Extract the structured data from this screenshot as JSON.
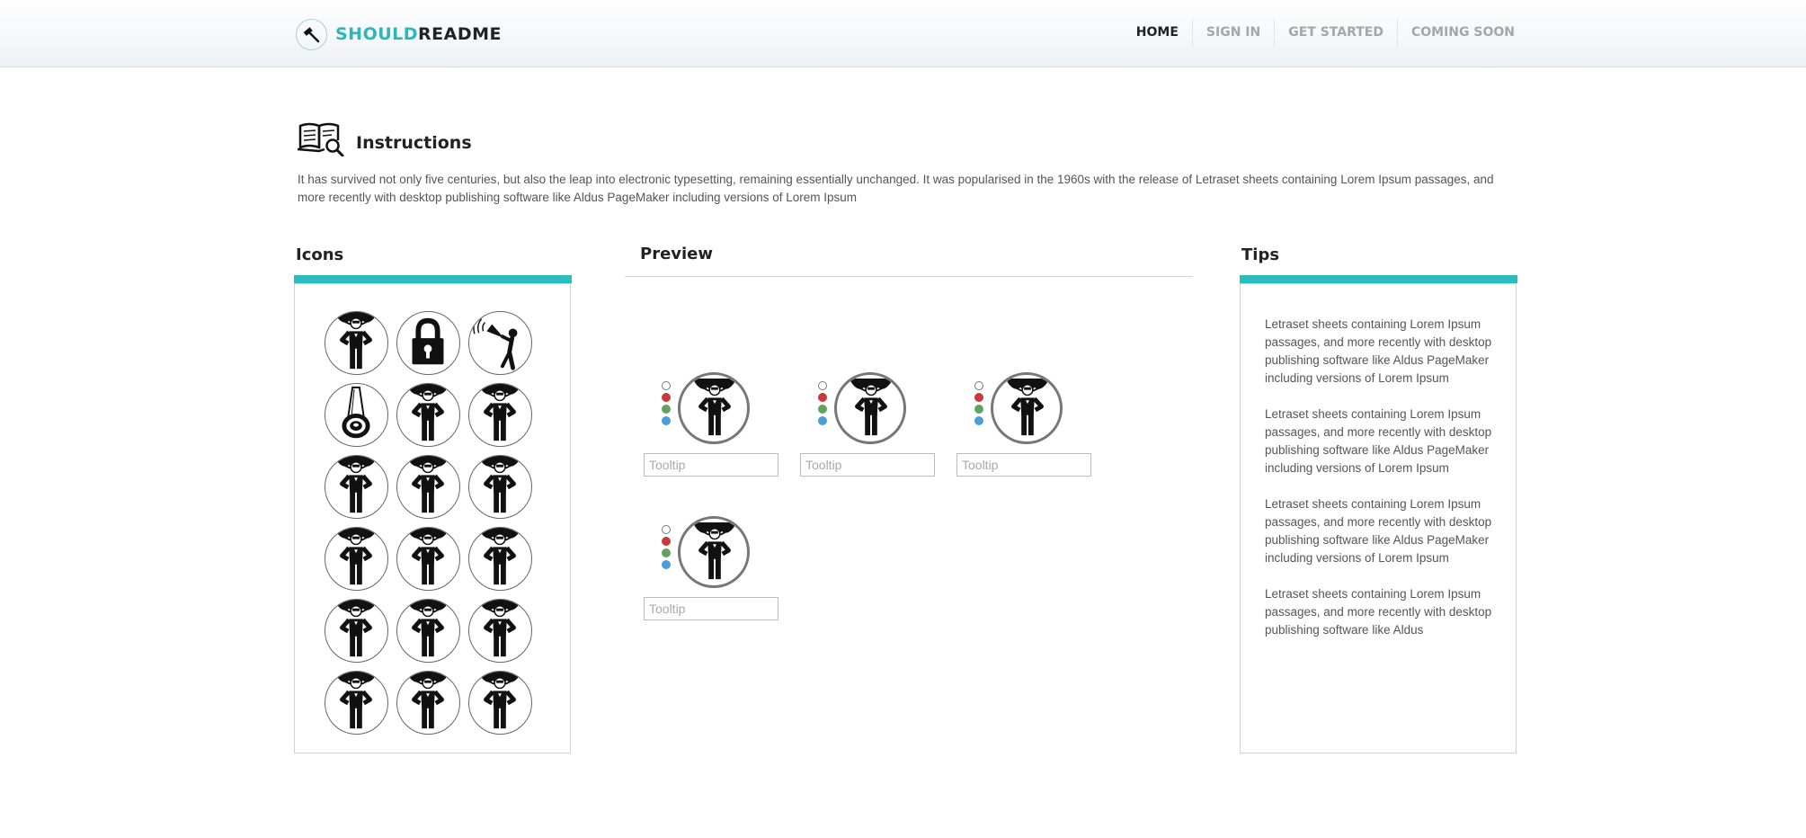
{
  "header": {
    "logo": {
      "accent": "SHOULD",
      "rest": "README",
      "icon": "hammer-icon"
    },
    "nav": [
      {
        "label": "HOME",
        "active": true
      },
      {
        "label": "SIGN IN",
        "active": false
      },
      {
        "label": "GET STARTED",
        "active": false
      },
      {
        "label": "COMING SOON",
        "active": false
      }
    ]
  },
  "instructions": {
    "icon": "book-search-icon",
    "title": "Instructions",
    "text": "It has survived not only five centuries, but also the leap into electronic typesetting, remaining essentially unchanged. It was popularised in the 1960s with the release of Letraset sheets containing Lorem Ipsum passages, and more recently with desktop publishing software like Aldus PageMaker including versions of Lorem Ipsum"
  },
  "icons_panel": {
    "title": "Icons",
    "items": [
      "superhero-icon",
      "lock-icon",
      "megaphone-person-icon",
      "flashlight-icon",
      "superhero-icon",
      "superhero-icon",
      "superhero-icon",
      "superhero-icon",
      "superhero-icon",
      "superhero-icon",
      "superhero-icon",
      "superhero-icon",
      "superhero-icon",
      "superhero-icon",
      "superhero-icon",
      "superhero-icon",
      "superhero-icon",
      "superhero-icon"
    ]
  },
  "preview": {
    "title": "Preview",
    "items": [
      {
        "icon": "superhero-icon",
        "tooltip_value": "",
        "tooltip_placeholder": "Tooltip"
      },
      {
        "icon": "superhero-icon",
        "tooltip_value": "",
        "tooltip_placeholder": "Tooltip"
      },
      {
        "icon": "superhero-icon",
        "tooltip_value": "",
        "tooltip_placeholder": "Tooltip"
      },
      {
        "icon": "superhero-icon",
        "tooltip_value": "",
        "tooltip_placeholder": "Tooltip"
      }
    ],
    "color_options": [
      "#ffffff",
      "#c9393a",
      "#5ea35e",
      "#4b9fd7"
    ]
  },
  "tips": {
    "title": "Tips",
    "items": [
      "Letraset sheets containing Lorem Ipsum passages, and more recently with desktop publishing software like Aldus PageMaker including versions of Lorem Ipsum",
      "Letraset sheets containing Lorem Ipsum passages, and more recently with desktop publishing software like Aldus PageMaker including versions of Lorem Ipsum",
      "Letraset sheets containing Lorem Ipsum passages, and more recently with desktop publishing software like Aldus PageMaker including versions of Lorem Ipsum",
      "Letraset sheets containing Lorem Ipsum passages, and more recently with desktop publishing software like Aldus"
    ]
  },
  "colors": {
    "accent": "#2bbdbd",
    "text": "#555555",
    "heading": "#222222",
    "nav_inactive": "#a2a7ab"
  }
}
